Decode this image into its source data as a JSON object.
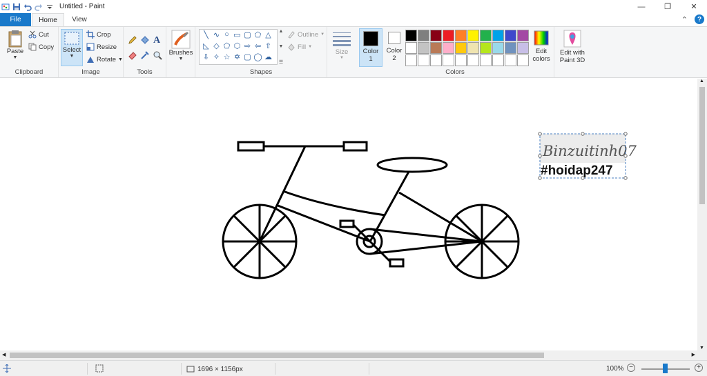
{
  "window": {
    "title": "Untitled - Paint",
    "minimize_glyph": "—",
    "restore_glyph": "❐",
    "close_glyph": "✕"
  },
  "tabs": {
    "file": "File",
    "home": "Home",
    "view": "View",
    "collapse_glyph": "⌃",
    "help_glyph": "?"
  },
  "ribbon": {
    "clipboard": {
      "label": "Clipboard",
      "paste": "Paste",
      "cut": "Cut",
      "copy": "Copy"
    },
    "image": {
      "label": "Image",
      "select": "Select",
      "crop": "Crop",
      "resize": "Resize",
      "rotate": "Rotate"
    },
    "tools": {
      "label": "Tools"
    },
    "brushes": {
      "label": "Brushes"
    },
    "shapes": {
      "label": "Shapes",
      "outline": "Outline",
      "fill": "Fill"
    },
    "size": {
      "label": "Size"
    },
    "colors": {
      "label": "Colors",
      "color1": "Color",
      "color1_num": "1",
      "color2": "Color",
      "color2_num": "2",
      "color1_value": "#000000",
      "color2_value": "#ffffff",
      "edit_colors": "Edit",
      "edit_colors2": "colors",
      "palette": [
        "#000000",
        "#7f7f7f",
        "#880015",
        "#ed1c24",
        "#ff7f27",
        "#fff200",
        "#22b14c",
        "#00a2e8",
        "#3f48cc",
        "#a349a4",
        "#ffffff",
        "#c3c3c3",
        "#b97a57",
        "#ffaec9",
        "#ffc90e",
        "#efe4b0",
        "#b5e61d",
        "#99d9ea",
        "#7092be",
        "#c8bfe7",
        "#ffffff",
        "#ffffff",
        "#ffffff",
        "#ffffff",
        "#ffffff",
        "#ffffff",
        "#ffffff",
        "#ffffff",
        "#ffffff",
        "#ffffff"
      ]
    },
    "paint3d": {
      "line1": "Edit with",
      "line2": "Paint 3D"
    }
  },
  "canvas": {
    "signature": "Binzuitinh07",
    "hashtag": "#hoidap247"
  },
  "status": {
    "image_size": "1696 × 1156px",
    "zoom": "100%"
  }
}
